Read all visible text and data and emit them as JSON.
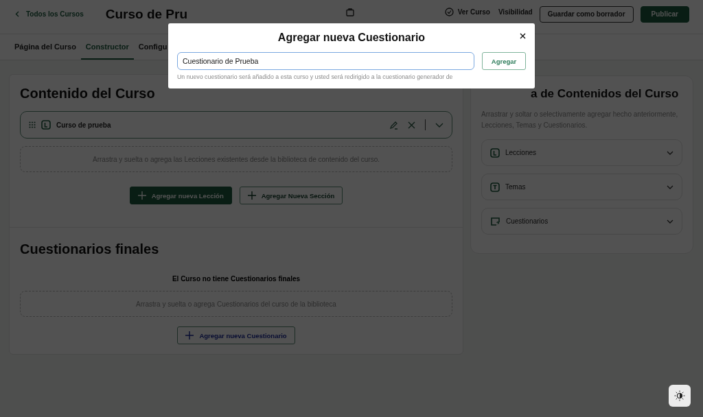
{
  "header": {
    "back_link": "Todos los Cursos",
    "course_title": "Curso de Pru",
    "links": [
      {
        "kind": "view",
        "label": "Ver Curso"
      },
      {
        "kind": "status",
        "label": "Visibilidad"
      }
    ],
    "buttons": [
      {
        "label": "Guardar como borrador",
        "kind": "outline"
      },
      {
        "label": "Publicar",
        "kind": "primary"
      }
    ]
  },
  "tabs": [
    {
      "label": "Página del Curso",
      "selected": false
    },
    {
      "label": "Constructor",
      "selected": true
    },
    {
      "label": "Configu",
      "selected": false
    }
  ],
  "course_content": {
    "title": "Contenido del Curso",
    "sections": [
      {
        "title": "Curso de prueba"
      }
    ],
    "dropzone": "Arrastra y suelta o agrega las Lecciones existentes desde la biblioteca de contenido del curso.",
    "buttons": [
      {
        "label": "Agregar nueva Lección",
        "kind": "primary"
      },
      {
        "label": "Agregar Nueva Sección",
        "kind": "outline"
      }
    ]
  },
  "final_quizzes": {
    "title": "Cuestionarios finales",
    "empty_message": "El Curso no tiene Cuestionarios finales",
    "dropzone": "Arrastra y suelta o agrega Cuestionarios del curso de la biblioteca",
    "button": "Agregar nueva Cuestionario"
  },
  "library": {
    "title": "a de Contenidos del Curso",
    "description": "Arrastrar y soltar o selectivamente agregar hecho anteriormente, Lecciones, Temas y Cuestionarios.",
    "groups": [
      {
        "label": "Lecciones",
        "kind": "lesson"
      },
      {
        "label": "Temas",
        "kind": "topic"
      },
      {
        "label": "Cuestionarios",
        "kind": "quiz"
      }
    ]
  },
  "modal": {
    "title": "Agregar nueva Cuestionario",
    "input": {
      "value": "Cuestionario de Prueba"
    },
    "button": "Agregar",
    "hint": "Un nuevo cuestionario será añadido a esta curso y usted será redirigido a la cuestionario generador de"
  }
}
